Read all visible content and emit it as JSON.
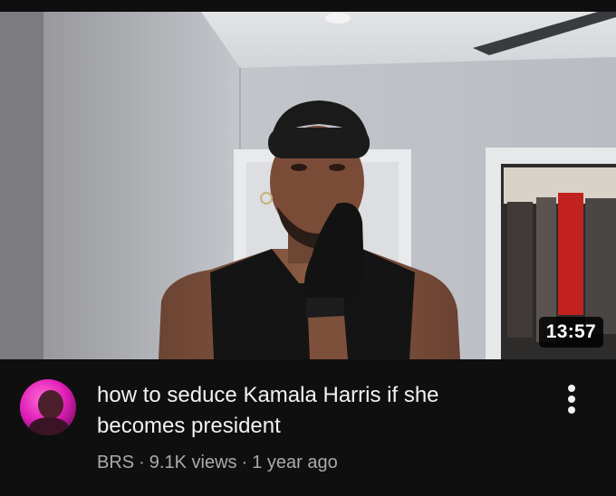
{
  "video": {
    "duration": "13:57",
    "title": "how to seduce Kamala Harris if she becomes president",
    "channel": "BRS",
    "separator": "·",
    "views": "9.1K views",
    "age": "1 year ago"
  },
  "icons": {
    "more": "more-vert-icon",
    "avatar": "channel-avatar"
  },
  "colors": {
    "background": "#0f0f0f",
    "title": "#f1f1f1",
    "meta": "#aaaaaa",
    "avatar_accent": "#e01fb8"
  }
}
